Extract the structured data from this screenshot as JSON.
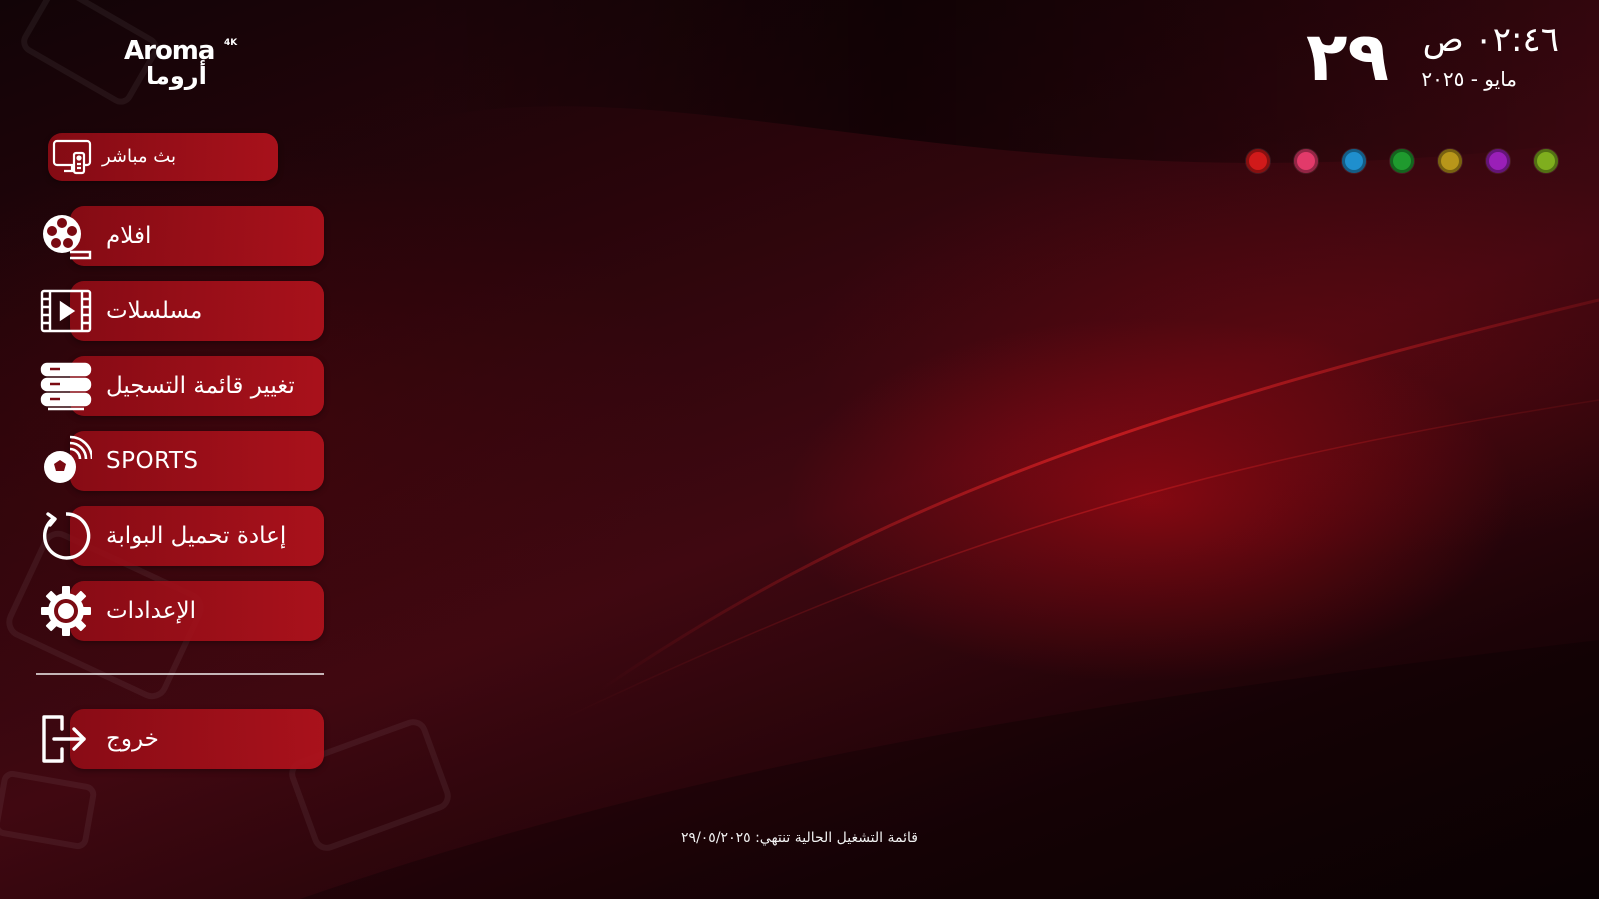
{
  "logo": {
    "latin": "Aroma",
    "badge": "4K",
    "arabic": "أروما"
  },
  "clock": {
    "day": "٢٩",
    "time": "٠٢:٤٦ ص",
    "date": "مايو - ٢٠٢٥"
  },
  "color_dots": [
    {
      "name": "red",
      "color": "#d11a1a"
    },
    {
      "name": "pink",
      "color": "#e23a6a"
    },
    {
      "name": "blue",
      "color": "#1f8fce"
    },
    {
      "name": "green",
      "color": "#1f9a2e"
    },
    {
      "name": "gold",
      "color": "#b8961a"
    },
    {
      "name": "purple",
      "color": "#9a1fb8"
    },
    {
      "name": "olive",
      "color": "#7fae1e"
    }
  ],
  "menu": {
    "items": [
      {
        "id": "live",
        "label": "بث مباشر",
        "icon": "tv-remote-icon"
      },
      {
        "id": "movies",
        "label": "افلام",
        "icon": "film-reel-icon"
      },
      {
        "id": "series",
        "label": "مسلسلات",
        "icon": "film-strip-play-icon"
      },
      {
        "id": "playlist",
        "label": "تغيير قائمة التسجيل",
        "icon": "server-list-icon"
      },
      {
        "id": "sports",
        "label": "SPORTS",
        "icon": "soccer-ball-signal-icon"
      },
      {
        "id": "reload",
        "label": "إعادة تحميل البوابة",
        "icon": "refresh-icon"
      },
      {
        "id": "settings",
        "label": "الإعدادات",
        "icon": "gear-icon"
      },
      {
        "id": "exit",
        "label": "خروج",
        "icon": "exit-icon"
      }
    ]
  },
  "footer": {
    "note": "قائمة التشغيل الحالية تنتهي: ٢٩/٠٥/٢٠٢٥"
  }
}
